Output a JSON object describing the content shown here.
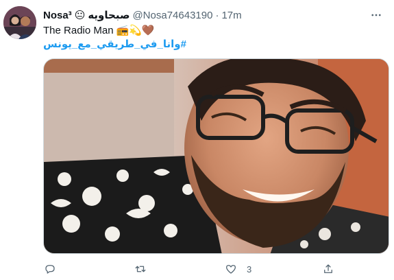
{
  "tweet": {
    "author_name": "Nosa³",
    "author_emoji": "😐",
    "author_name_ar": "صبحاويه",
    "handle": "@Nosa74643190",
    "separator": "·",
    "time": "17m",
    "text": "The Radio Man",
    "text_emojis": "📻💫🤎",
    "hashtag": "#وانا_في_طريقي_مع_يونس"
  },
  "actions": {
    "reply_count": "",
    "retweet_count": "",
    "like_count": "3",
    "share_count": ""
  },
  "icons": {
    "more": "more-dots-icon",
    "reply": "reply-icon",
    "retweet": "retweet-icon",
    "like": "heart-icon",
    "share": "share-icon"
  },
  "colors": {
    "link": "#1d9bf0",
    "muted": "#536471",
    "text": "#0f1419"
  }
}
